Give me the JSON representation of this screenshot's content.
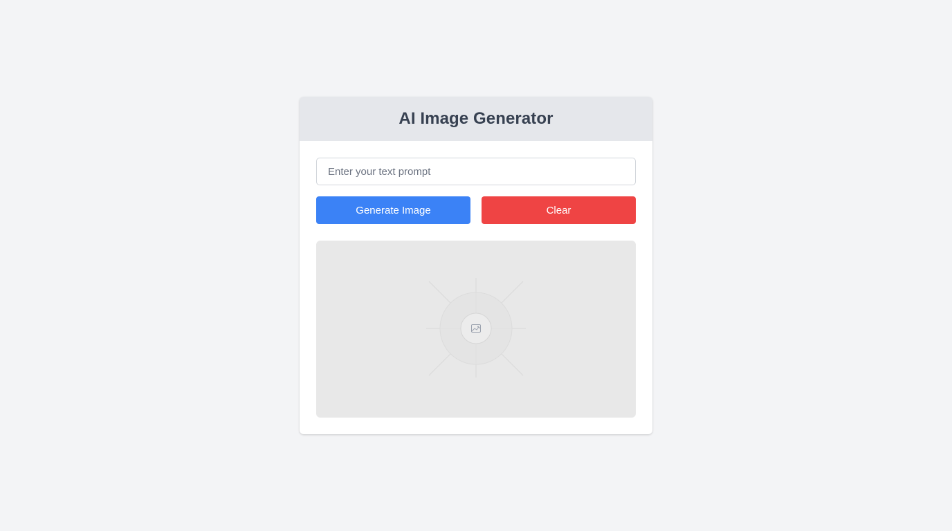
{
  "app": {
    "title": "AI Image Generator"
  },
  "prompt": {
    "placeholder": "Enter your text prompt",
    "value": ""
  },
  "actions": {
    "generate_label": "Generate Image",
    "clear_label": "Clear"
  },
  "image_output": {
    "icon": "image-placeholder-icon",
    "state": "empty"
  },
  "colors": {
    "background": "#f3f4f6",
    "header_background": "#e5e7eb",
    "title_text": "#374151",
    "generate_button": "#3b82f6",
    "clear_button": "#ef4444",
    "image_area": "#e8e8e8"
  }
}
